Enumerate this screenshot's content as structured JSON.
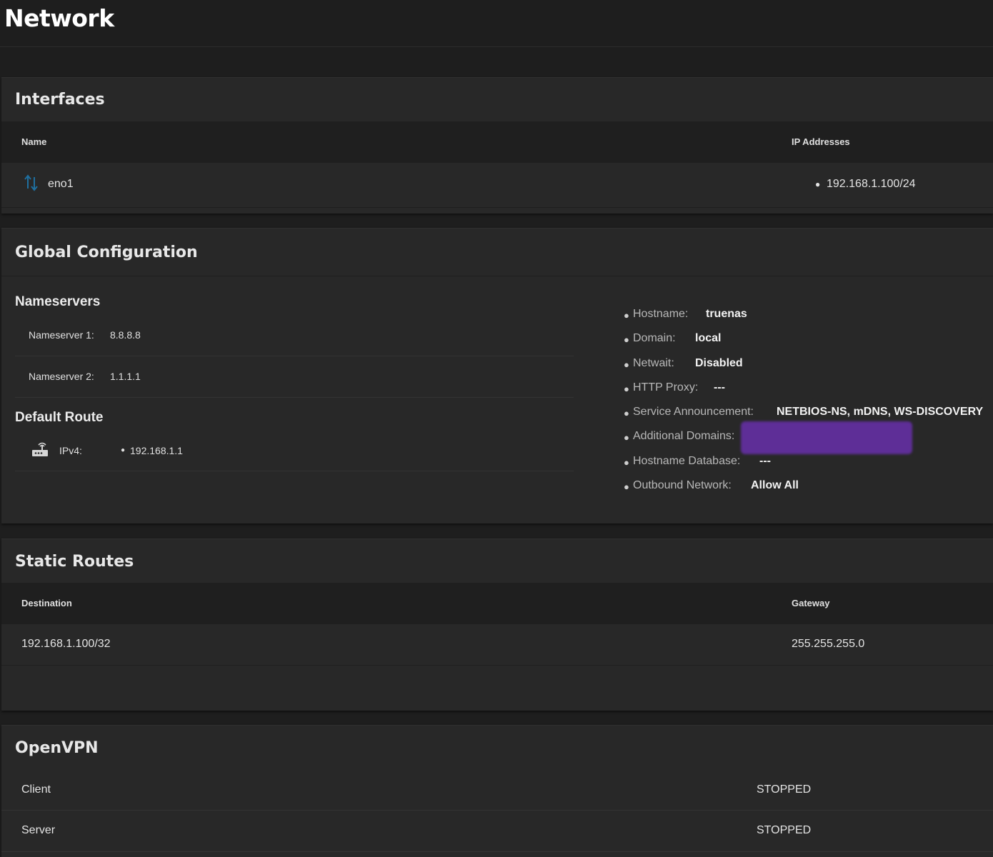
{
  "page": {
    "title": "Network"
  },
  "interfaces": {
    "title": "Interfaces",
    "columns": [
      "Name",
      "IP Addresses"
    ],
    "rows": [
      {
        "name": "eno1",
        "icon": "up-down-arrows-icon",
        "ip": "192.168.1.100/24"
      }
    ]
  },
  "global_config": {
    "title": "Global Configuration",
    "nameservers": {
      "title": "Nameservers",
      "items": [
        {
          "label": "Nameserver 1:",
          "value": "8.8.8.8"
        },
        {
          "label": "Nameserver 2:",
          "value": "1.1.1.1"
        }
      ]
    },
    "default_route": {
      "title": "Default Route",
      "icon": "router-icon",
      "label": "IPv4:",
      "value": "192.168.1.1"
    },
    "info": [
      {
        "key": "Hostname:",
        "value": "truenas"
      },
      {
        "key": "Domain:",
        "value": "local"
      },
      {
        "key": "Netwait:",
        "value": "Disabled"
      },
      {
        "key": "HTTP Proxy:",
        "value": "---"
      },
      {
        "key": "Service Announcement:",
        "value": "NETBIOS-NS, mDNS, WS-DISCOVERY"
      },
      {
        "key": "Additional Domains:",
        "value": ""
      },
      {
        "key": "Hostname Database:",
        "value": "---"
      },
      {
        "key": "Outbound Network:",
        "value": "Allow All"
      }
    ]
  },
  "static_routes": {
    "title": "Static Routes",
    "columns": [
      "Destination",
      "Gateway"
    ],
    "rows": [
      {
        "destination": "192.168.1.100/32",
        "gateway": "255.255.255.0"
      }
    ]
  },
  "openvpn": {
    "title": "OpenVPN",
    "rows": [
      {
        "name": "Client",
        "status": "STOPPED"
      },
      {
        "name": "Server",
        "status": "STOPPED"
      }
    ]
  },
  "colors": {
    "background": "#1e1e1e",
    "card": "#282828",
    "table_header": "#1f1f1f",
    "icon_accent": "#1f7cb0",
    "redaction": "#5e2e97"
  }
}
